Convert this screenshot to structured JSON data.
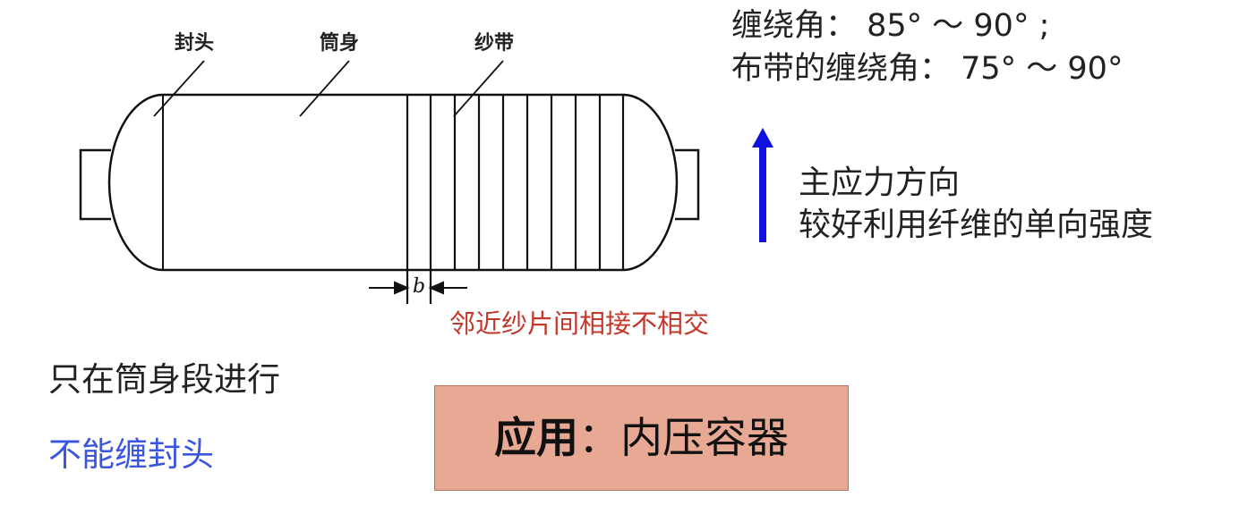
{
  "labels": {
    "head": "封头",
    "body": "筒身",
    "band": "纱带",
    "gap_symbol": "b"
  },
  "angles": {
    "line1": "缠绕角： 85° ～ 90° ;",
    "line2": "布带的缠绕角： 75° ～ 90°"
  },
  "stress": {
    "line1": "主应力方向",
    "line2": "较好利用纤维的单向强度"
  },
  "red_note": "邻近纱片间相接不相交",
  "notes": {
    "line1": "只在筒身段进行",
    "line2": "不能缠封头"
  },
  "application": {
    "label": "应用",
    "colon": "：",
    "value": "内压容器"
  },
  "colors": {
    "arrow": "#1010e0",
    "red_note": "#c0392b",
    "blue_note": "#3a55e0",
    "box_fill": "#e8a994"
  },
  "icons": {
    "stress_arrow": "arrow-up-icon"
  }
}
